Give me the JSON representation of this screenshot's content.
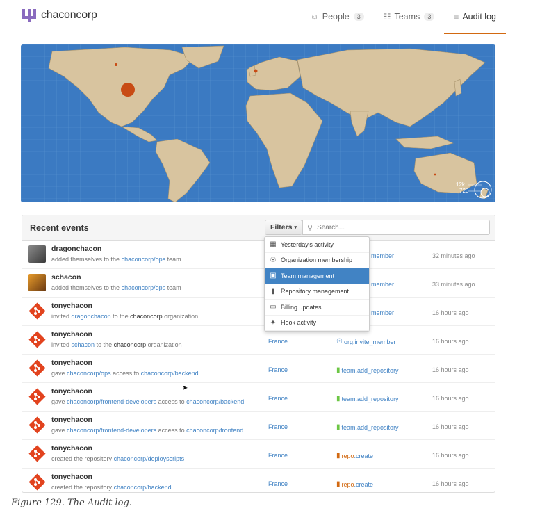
{
  "header": {
    "org_name": "chaconcorp",
    "nav": [
      {
        "label": "People",
        "count": "3",
        "icon": "people-icon"
      },
      {
        "label": "Teams",
        "count": "3",
        "icon": "teams-icon"
      },
      {
        "label": "Audit log",
        "icon": "list-icon"
      }
    ]
  },
  "map": {
    "legend_top": "12k",
    "legend_bottom": "720"
  },
  "events": {
    "title": "Recent events",
    "filters_label": "Filters",
    "search_placeholder": "Search...",
    "rows": [
      {
        "user": "dragonchacon",
        "desc": [
          {
            "t": "added themselves to the "
          },
          {
            "t": "chaconcorp/ops",
            "link": true
          },
          {
            "t": " team"
          }
        ],
        "loc": "",
        "action": "member",
        "time": "32 minutes ago"
      },
      {
        "user": "schacon",
        "desc": [
          {
            "t": "added themselves to the "
          },
          {
            "t": "chaconcorp/ops",
            "link": true
          },
          {
            "t": " team"
          }
        ],
        "loc": "",
        "action": "member",
        "time": "33 minutes ago"
      },
      {
        "user": "tonychacon",
        "desc": [
          {
            "t": "invited "
          },
          {
            "t": "dragonchacon",
            "link": true
          },
          {
            "t": " to the "
          },
          {
            "t": "chaconcorp",
            "strong": true
          },
          {
            "t": " organization"
          }
        ],
        "loc": "",
        "action": "member",
        "time": "16 hours ago"
      },
      {
        "user": "tonychacon",
        "desc": [
          {
            "t": "invited "
          },
          {
            "t": "schacon",
            "link": true
          },
          {
            "t": " to the "
          },
          {
            "t": "chaconcorp",
            "strong": true
          },
          {
            "t": " organization"
          }
        ],
        "loc": "France",
        "action": "org.invite_member",
        "time": "16 hours ago"
      },
      {
        "user": "tonychacon",
        "desc": [
          {
            "t": "gave "
          },
          {
            "t": "chaconcorp/ops",
            "link": true
          },
          {
            "t": " access to "
          },
          {
            "t": "chaconcorp/backend",
            "link": true
          }
        ],
        "loc": "France",
        "action": "team.add_repository",
        "time": "16 hours ago"
      },
      {
        "user": "tonychacon",
        "desc": [
          {
            "t": "gave "
          },
          {
            "t": "chaconcorp/frontend-developers",
            "link": true
          },
          {
            "t": " access to "
          },
          {
            "t": "chaconcorp/backend",
            "link": true
          }
        ],
        "loc": "France",
        "action": "team.add_repository",
        "time": "16 hours ago"
      },
      {
        "user": "tonychacon",
        "desc": [
          {
            "t": "gave "
          },
          {
            "t": "chaconcorp/frontend-developers",
            "link": true
          },
          {
            "t": " access to "
          },
          {
            "t": "chaconcorp/frontend",
            "link": true
          }
        ],
        "loc": "France",
        "action": "team.add_repository",
        "time": "16 hours ago"
      },
      {
        "user": "tonychacon",
        "desc": [
          {
            "t": "created the repository "
          },
          {
            "t": "chaconcorp/deployscripts",
            "link": true
          }
        ],
        "loc": "France",
        "action": "repo.create",
        "time": "16 hours ago"
      },
      {
        "user": "tonychacon",
        "desc": [
          {
            "t": "created the repository "
          },
          {
            "t": "chaconcorp/backend",
            "link": true
          }
        ],
        "loc": "France",
        "action": "repo.create",
        "time": "16 hours ago"
      }
    ]
  },
  "filters_menu": [
    {
      "label": "Yesterday's activity",
      "icon": "calendar-icon"
    },
    {
      "label": "Organization membership",
      "icon": "globe-icon"
    },
    {
      "label": "Team management",
      "icon": "team-icon",
      "selected": true
    },
    {
      "label": "Repository management",
      "icon": "repo-icon"
    },
    {
      "label": "Billing updates",
      "icon": "credit-card-icon"
    },
    {
      "label": "Hook activity",
      "icon": "hook-icon"
    }
  ],
  "caption": "Figure 129. The Audit log.",
  "colors": {
    "accent": "#d26911",
    "link": "#4183c4",
    "ocean": "#3b7ac2",
    "land": "#d8c49f",
    "selected": "#4183c4"
  }
}
